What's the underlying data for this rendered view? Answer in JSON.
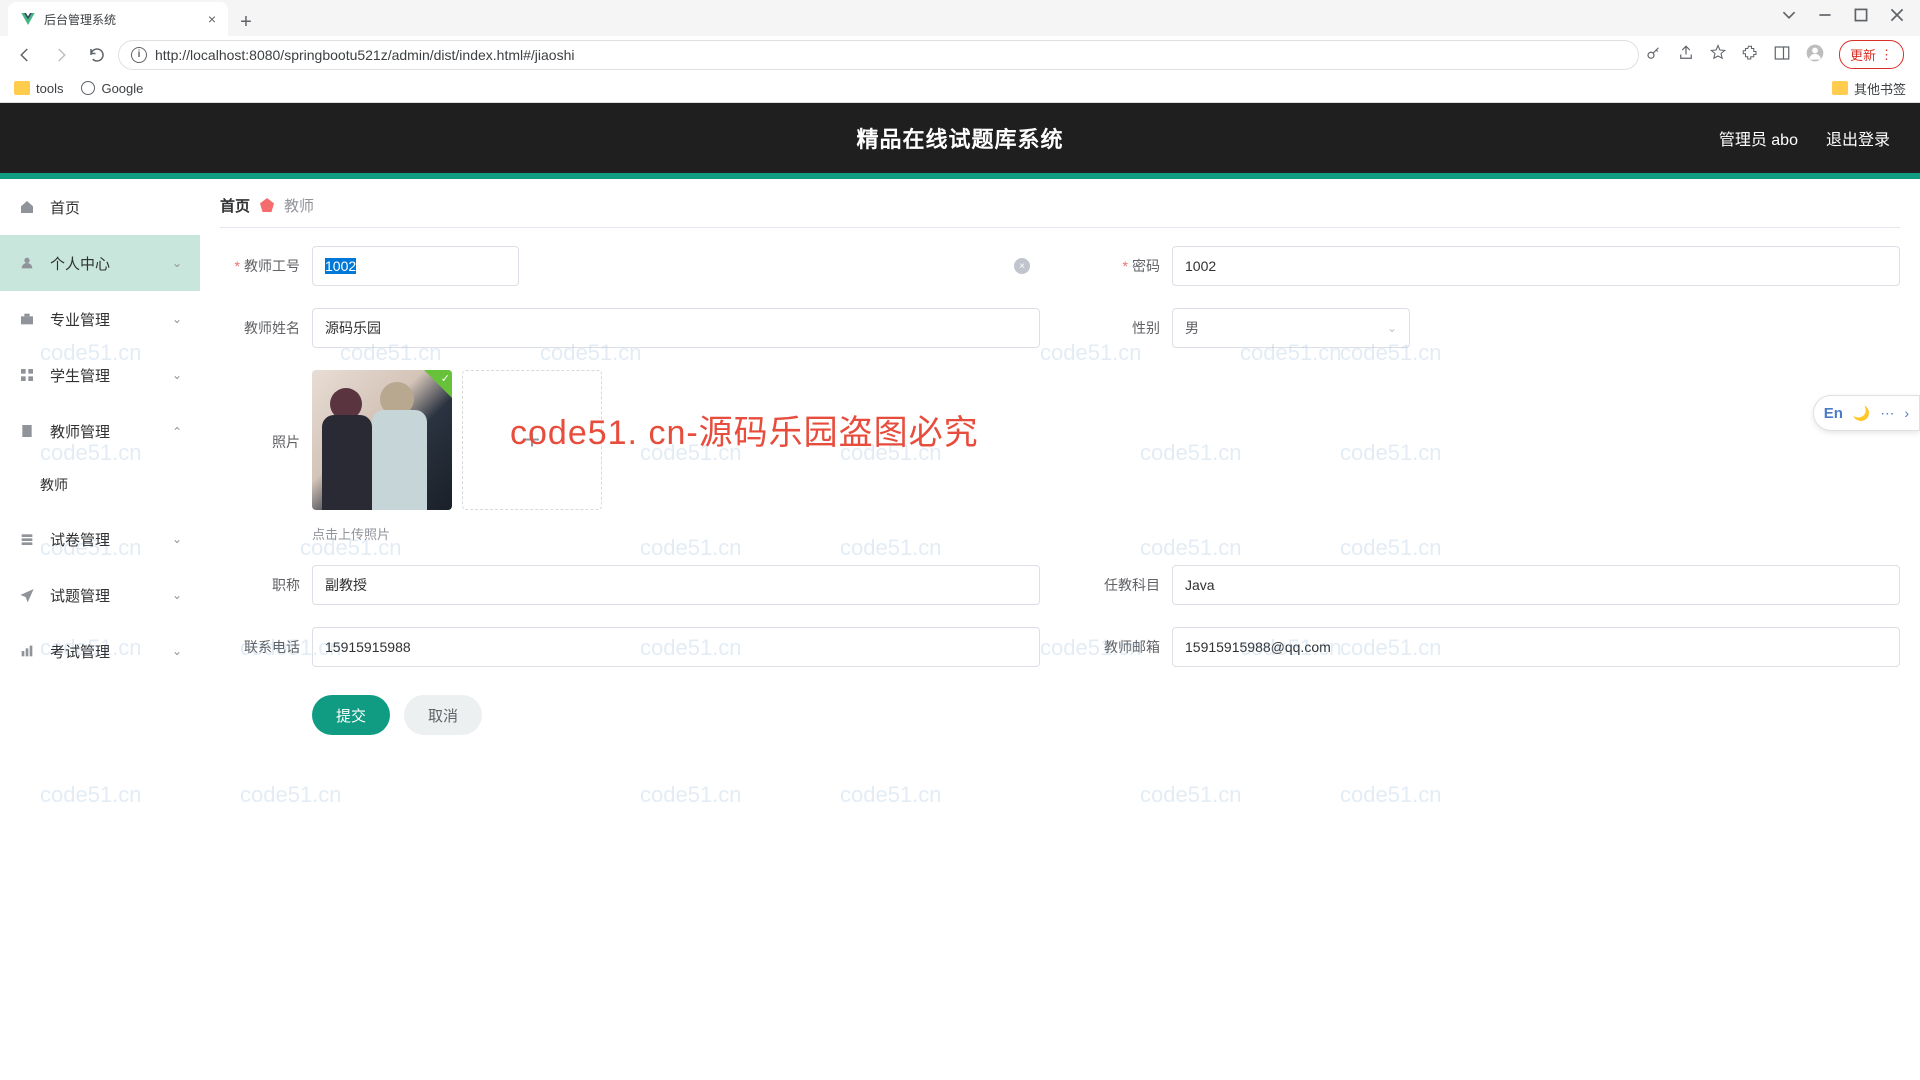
{
  "browser": {
    "tab_title": "后台管理系统",
    "url": "http://localhost:8080/springbootu521z/admin/dist/index.html#/jiaoshi",
    "update_label": "更新",
    "bookmarks": {
      "tools": "tools",
      "google": "Google",
      "other": "其他书签"
    }
  },
  "header": {
    "title": "精品在线试题库系统",
    "user_role": "管理员 abo",
    "logout": "退出登录"
  },
  "sidebar": {
    "items": [
      {
        "label": "首页",
        "icon": "home-icon",
        "kind": "link"
      },
      {
        "label": "个人中心",
        "icon": "user-icon",
        "kind": "group",
        "active": true
      },
      {
        "label": "专业管理",
        "icon": "case-icon",
        "kind": "group"
      },
      {
        "label": "学生管理",
        "icon": "grid-icon",
        "kind": "group"
      },
      {
        "label": "教师管理",
        "icon": "doc-icon",
        "kind": "group",
        "expanded": true,
        "children": [
          {
            "label": "教师"
          }
        ]
      },
      {
        "label": "试卷管理",
        "icon": "layers-icon",
        "kind": "group"
      },
      {
        "label": "试题管理",
        "icon": "send-icon",
        "kind": "group"
      },
      {
        "label": "考试管理",
        "icon": "chart-icon",
        "kind": "group"
      }
    ]
  },
  "breadcrumb": {
    "home": "首页",
    "current": "教师"
  },
  "form": {
    "teacher_id": {
      "label": "教师工号",
      "value": "1002",
      "required": true
    },
    "password": {
      "label": "密码",
      "value": "1002",
      "required": true
    },
    "teacher_name": {
      "label": "教师姓名",
      "value": "源码乐园"
    },
    "gender": {
      "label": "性别",
      "value": "男"
    },
    "photo": {
      "label": "照片",
      "hint": "点击上传照片"
    },
    "title": {
      "label": "职称",
      "value": "副教授"
    },
    "subject": {
      "label": "任教科目",
      "value": "Java"
    },
    "phone": {
      "label": "联系电话",
      "value": "15915915988"
    },
    "email": {
      "label": "教师邮箱",
      "value": "15915915988@qq.com"
    },
    "submit": "提交",
    "cancel": "取消"
  },
  "watermark": "code51.cn",
  "big_watermark": "code51. cn-源码乐园盗图必究",
  "ime": {
    "mode": "En"
  }
}
